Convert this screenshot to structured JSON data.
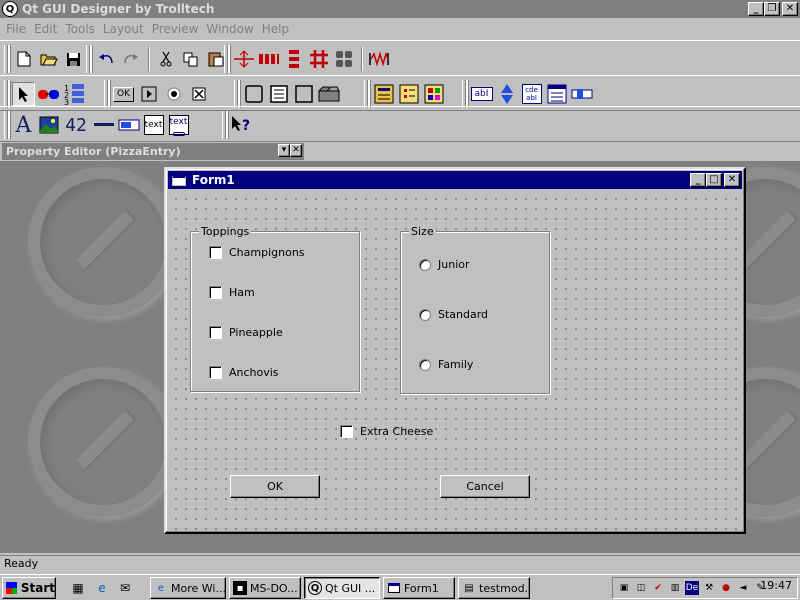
{
  "app": {
    "title": "Qt GUI Designer by Trolltech",
    "icon_letter": "Q"
  },
  "menubar": {
    "items": [
      "File",
      "Edit",
      "Tools",
      "Layout",
      "Preview",
      "Window",
      "Help"
    ]
  },
  "toolbar_text": {
    "push_button": "OK",
    "lcd_number": "42",
    "text_label": "text",
    "text_browser": "text",
    "line_edit": "abI",
    "multi_line_edit": "cde abI",
    "whats_this": "?"
  },
  "property_editor": {
    "title": "Property Editor (PizzaEntry)"
  },
  "form": {
    "title": "Form1",
    "toppings": {
      "title": "Toppings",
      "items": [
        "Champignons",
        "Ham",
        "Pineapple",
        "Anchovis"
      ]
    },
    "size": {
      "title": "Size",
      "items": [
        "Junior",
        "Standard",
        "Family"
      ]
    },
    "extra_cheese": "Extra Cheese",
    "ok_label": "OK",
    "cancel_label": "Cancel"
  },
  "status": {
    "text": "Ready"
  },
  "taskbar": {
    "start_label": "Start",
    "tasks": [
      "More Wi...",
      "MS-DO...",
      "Qt GUI ...",
      "Form1",
      "testmod..."
    ],
    "clock": "19:47",
    "tray_lang": "De"
  },
  "colors": {
    "active_title": "#000080",
    "inactive_title": "#808080",
    "face": "#c0c0c0",
    "workspace": "#808080"
  }
}
